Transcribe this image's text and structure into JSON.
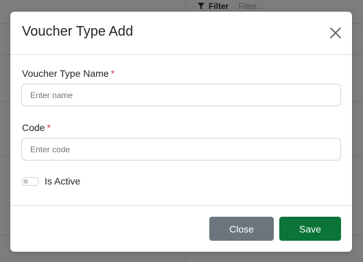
{
  "background": {
    "filter_label": "Filter",
    "filter_placeholder": "Filter..."
  },
  "modal": {
    "title": "Voucher Type Add",
    "close_icon": "close-icon",
    "fields": {
      "name": {
        "label": "Voucher Type Name",
        "required_mark": "*",
        "placeholder": "Enter name",
        "value": ""
      },
      "code": {
        "label": "Code",
        "required_mark": "*",
        "placeholder": "Enter code",
        "value": ""
      }
    },
    "is_active": {
      "label": "Is Active",
      "checked": false
    },
    "buttons": {
      "close": "Close",
      "save": "Save"
    }
  },
  "colors": {
    "save_button": "#0b7438",
    "close_button": "#6c757d",
    "required": "#dc3545"
  }
}
